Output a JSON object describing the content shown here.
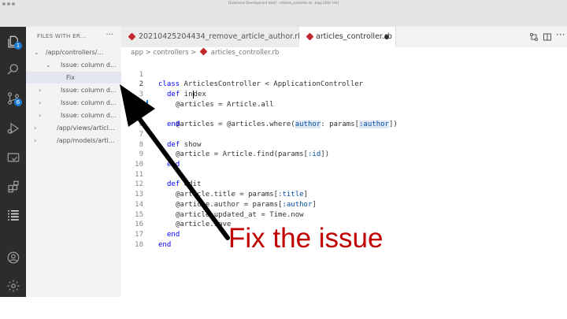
{
  "window": {
    "title": "[Extension Development Host] - articles_controller.rb - blog [SSH: lite]"
  },
  "activity_bar": {
    "items": [
      {
        "name": "explorer-icon",
        "badge": "1"
      },
      {
        "name": "search-icon"
      },
      {
        "name": "source-control-icon",
        "badge": "6"
      },
      {
        "name": "run-debug-icon"
      },
      {
        "name": "remote-explorer-icon"
      },
      {
        "name": "extensions-icon"
      },
      {
        "name": "list-view-icon"
      }
    ],
    "bottom": [
      {
        "name": "account-icon"
      },
      {
        "name": "settings-gear-icon"
      }
    ]
  },
  "sidebar": {
    "header": "FILES WITH ER...",
    "more": "···",
    "rows": [
      {
        "chevron": "⌄",
        "label": "/app/controllers/..."
      },
      {
        "chevron": "⌄",
        "label": "Issue: column d..."
      },
      {
        "chevron": "",
        "label": "Fix"
      },
      {
        "chevron": "›",
        "label": "Issue: column d..."
      },
      {
        "chevron": "›",
        "label": "Issue: column d..."
      },
      {
        "chevron": "›",
        "label": "Issue: column d..."
      },
      {
        "chevron": "›",
        "label": "/app/views/articl..."
      },
      {
        "chevron": "›",
        "label": "/app/models/arti..."
      }
    ]
  },
  "tabs": [
    {
      "label": "20210425204434_remove_article_author.rb",
      "active": false
    },
    {
      "label": "articles_controller.rb",
      "active": true
    }
  ],
  "breadcrumb": {
    "parts": [
      "app",
      "controllers",
      "articles_controller.rb"
    ],
    "separator": ">"
  },
  "code_lines": [
    {
      "num": "1",
      "text": "class ArticlesController < ApplicationController"
    },
    {
      "num": "2",
      "text": "def index"
    },
    {
      "num": "3",
      "text": "@articles = Article.all"
    },
    {
      "num": "4",
      "text": "@articles = @articles.where(author: params[:author])"
    },
    {
      "num": "5",
      "text": "end"
    },
    {
      "num": "6",
      "text": ""
    },
    {
      "num": "7",
      "text": "def show"
    },
    {
      "num": "8",
      "text": "@article = Article.find(params[:id])"
    },
    {
      "num": "9",
      "text": "end"
    },
    {
      "num": "10",
      "text": ""
    },
    {
      "num": "11",
      "text": "def edit"
    },
    {
      "num": "12",
      "text": "@article.title = params[:title]"
    },
    {
      "num": "13",
      "text": "@article.author = params[:author]"
    },
    {
      "num": "14",
      "text": "@article.updated_at = Time.now"
    },
    {
      "num": "15",
      "text": "@article.save"
    },
    {
      "num": "16",
      "text": "end"
    },
    {
      "num": "17",
      "text": "end"
    },
    {
      "num": "18",
      "text": ""
    }
  ],
  "annotation": {
    "text": "Fix the issue",
    "color": "#c00000"
  },
  "colors": {
    "keyword": "#0000ff",
    "symbol": "#0451a5",
    "activity_bg": "#2c2c2c",
    "badge": "#1a7ad4"
  }
}
